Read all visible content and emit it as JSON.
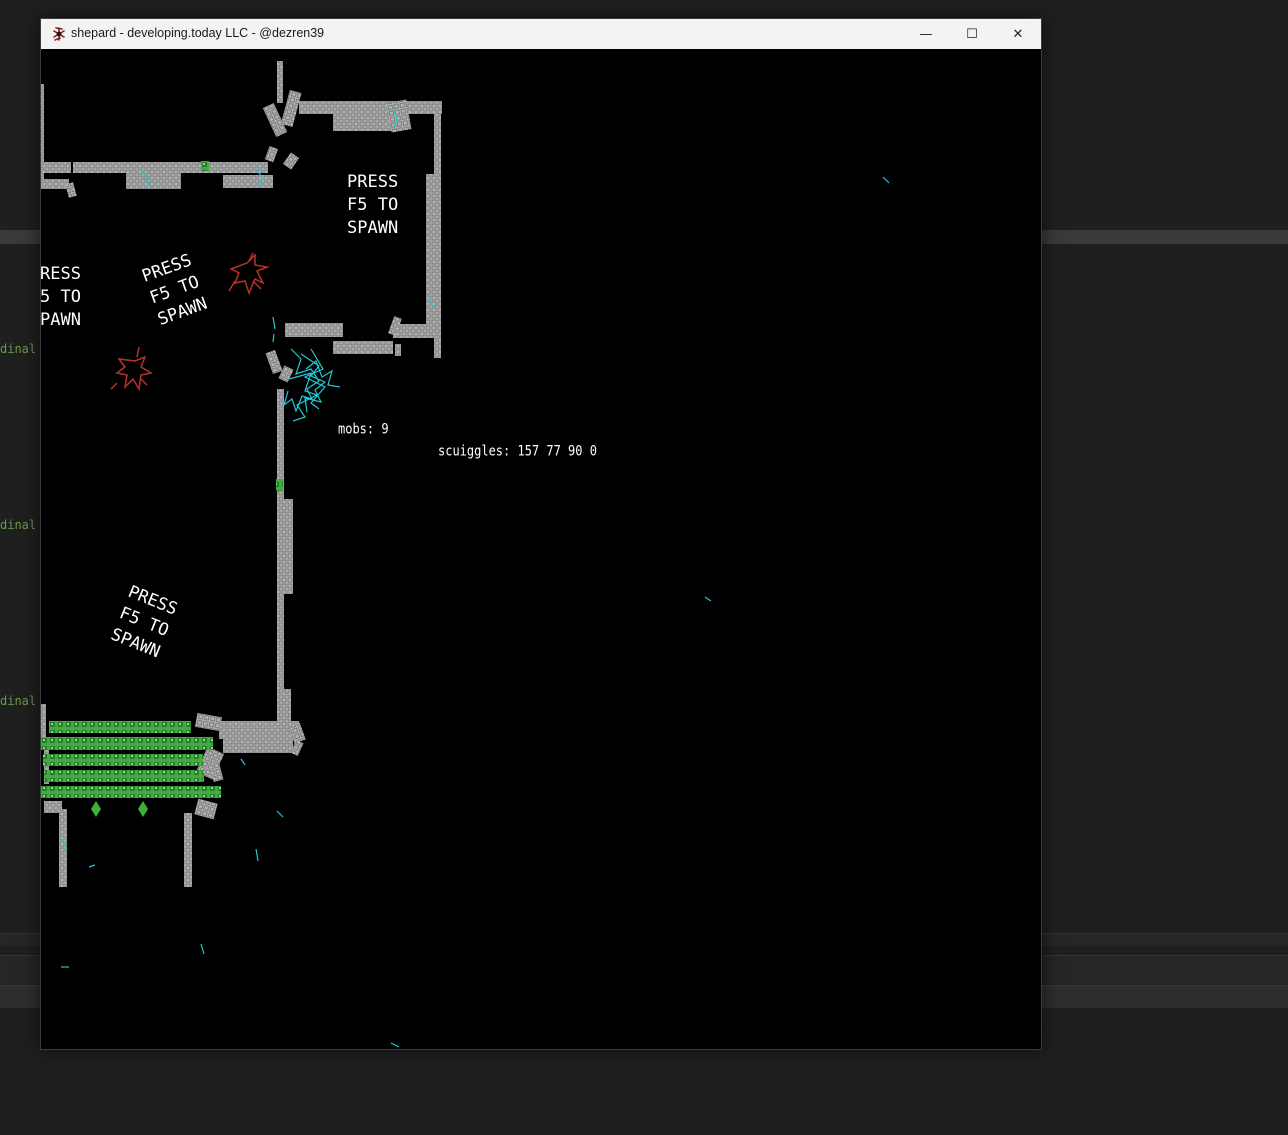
{
  "window": {
    "title": "shepard - developing.today LLC - @dezren39",
    "controls": {
      "minimize": "—",
      "maximize": "☐",
      "close": "✕"
    }
  },
  "background": {
    "code_fragments": [
      "dinal",
      "dinal",
      "dinal"
    ]
  },
  "game": {
    "hud": {
      "mobs": "mobs: 9",
      "sciggles": "scuiggles: 157 77 90 0"
    },
    "spawn_labels": [
      "PRESS\nF5 TO\nSPAWN",
      "RESS\n5 TO\nPAWN",
      "PRESS\nF5 TO\nSPAWN",
      "PRESS\nF5 TO\nSPAWN"
    ]
  },
  "colors": {
    "wall": "#a9a9a9",
    "grass": "#3fae3f",
    "scribble": "#22c7d6",
    "mob": "#b8322b",
    "titlebar": "#f3f3f3"
  }
}
